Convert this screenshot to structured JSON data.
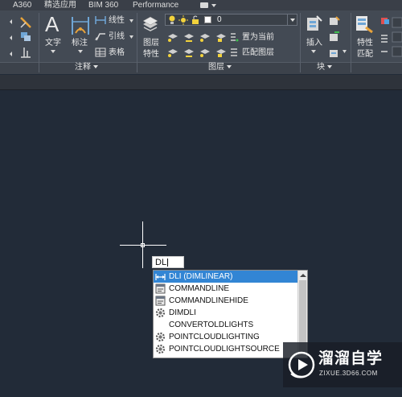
{
  "tabs": [
    "A360",
    "精选应用",
    "BIM 360",
    "Performance"
  ],
  "ribbon": {
    "annotation": {
      "text_label": "文字",
      "dimension_label": "标注",
      "linear_label": "线性",
      "leader_label": "引线",
      "table_label": "表格",
      "panel_title": "注释"
    },
    "layers": {
      "properties_label_1": "图层",
      "properties_label_2": "特性",
      "current_layer": "0",
      "set_current_label": "置为当前",
      "match_layer_label": "匹配图层",
      "panel_title": "图层"
    },
    "block": {
      "insert_label": "插入",
      "panel_title": "块"
    },
    "properties": {
      "match_label_1": "特性",
      "match_label_2": "匹配"
    }
  },
  "command_input": {
    "typed": "DLI"
  },
  "autocomplete": {
    "items": [
      {
        "label": "DLI (DIMLINEAR)",
        "icon": "dimlinear-icon",
        "selected": true
      },
      {
        "label": "COMMANDLINE",
        "icon": "command-window-icon",
        "selected": false
      },
      {
        "label": "COMMANDLINEHIDE",
        "icon": "command-window-icon",
        "selected": false
      },
      {
        "label": "DIMDLI",
        "icon": "gear-icon",
        "selected": false
      },
      {
        "label": "CONVERTOLDLIGHTS",
        "icon": "",
        "selected": false
      },
      {
        "label": "POINTCLOUDLIGHTING",
        "icon": "gear-icon",
        "selected": false
      },
      {
        "label": "POINTCLOUDLIGHTSOURCE",
        "icon": "gear-icon",
        "selected": false
      }
    ]
  },
  "watermark": {
    "title": "溜溜自学",
    "url": "ZIXUE.3D66.COM"
  },
  "colors": {
    "canvas": "#222b38",
    "ribbon": "#434a54",
    "selection": "#3285d4"
  }
}
